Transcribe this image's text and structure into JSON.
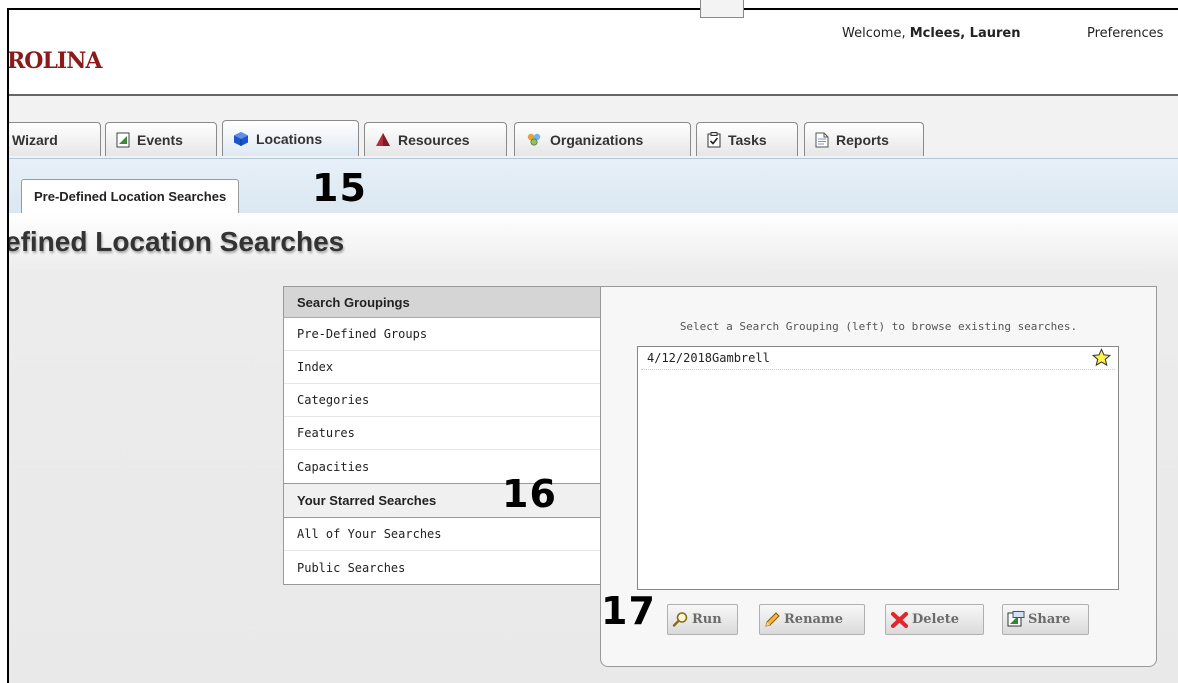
{
  "header": {
    "brand_fragment": "ROLINA",
    "welcome_prefix": "Welcome, ",
    "user_name": "Mclees, Lauren",
    "preferences": "Preferences"
  },
  "tabs": [
    {
      "label": "Wizard",
      "icon": "none"
    },
    {
      "label": "Events",
      "icon": "document-icon"
    },
    {
      "label": "Locations",
      "icon": "cube-icon"
    },
    {
      "label": "Resources",
      "icon": "pyramid-icon"
    },
    {
      "label": "Organizations",
      "icon": "people-icon"
    },
    {
      "label": "Tasks",
      "icon": "checklist-icon"
    },
    {
      "label": "Reports",
      "icon": "report-icon"
    }
  ],
  "active_tab": "Locations",
  "subtab": {
    "label": "Pre-Defined Location Searches"
  },
  "page_title": "efined Location Searches",
  "search_groupings": {
    "header": "Search Groupings",
    "items": [
      "Pre-Defined Groups",
      "Index",
      "Categories",
      "Features",
      "Capacities"
    ]
  },
  "starred": {
    "header": "Your Starred Searches",
    "items": [
      "All of Your Searches",
      "Public Searches"
    ]
  },
  "results_panel": {
    "hint": "Select a Search Grouping (left) to browse existing searches.",
    "results": [
      {
        "name": "4/12/2018Gambrell",
        "starred": true
      }
    ]
  },
  "actions": {
    "run": "Run",
    "rename": "Rename",
    "delete": "Delete",
    "share": "Share"
  },
  "callouts": {
    "c15": "15",
    "c16": "16",
    "c17": "17"
  },
  "colors": {
    "brand": "#8b1a1a",
    "active_tab_icon": "#1a56c9",
    "resources_icon": "#b02d3b"
  }
}
